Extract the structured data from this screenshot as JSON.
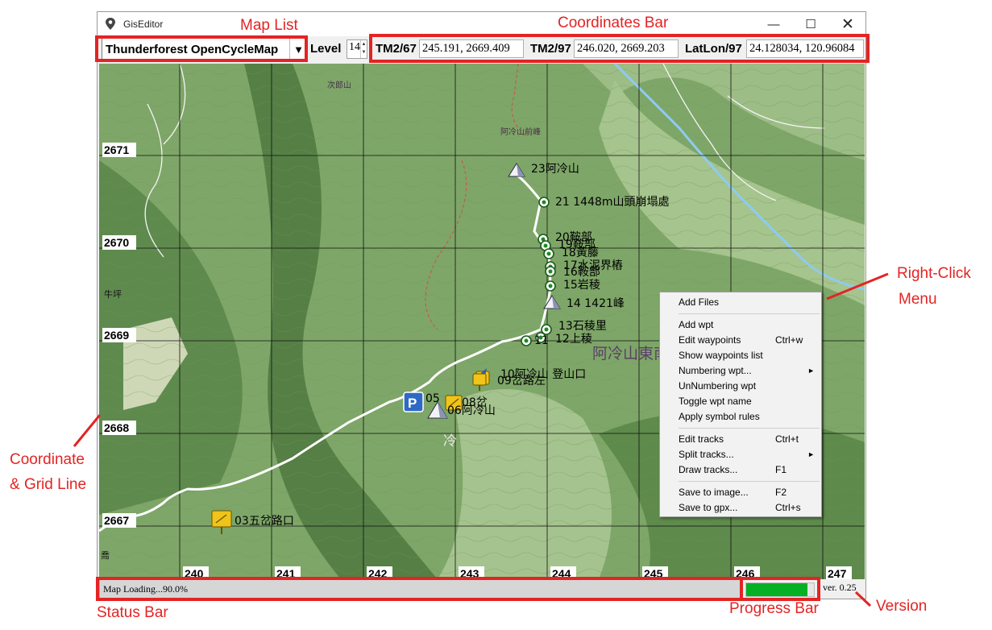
{
  "window": {
    "title": "GisEditor",
    "minimize_glyph": "—",
    "maximize_glyph": "☐",
    "close_glyph": "✕"
  },
  "toolbar": {
    "map_source": "Thunderforest OpenCycleMap",
    "map_dropdown_glyph": "▼",
    "level_label": "Level",
    "level_value": "14",
    "coords": [
      {
        "label": "TM2/67",
        "value": "245.191, 2669.409"
      },
      {
        "label": "TM2/97",
        "value": "246.020, 2669.203"
      },
      {
        "label": "LatLon/97",
        "value": "24.128034, 120.96084"
      }
    ]
  },
  "map": {
    "grid_y_labels": [
      "2671",
      "2670",
      "2669",
      "2668",
      "2667"
    ],
    "grid_x_labels": [
      "240",
      "241",
      "242",
      "243",
      "244",
      "245",
      "246",
      "247"
    ],
    "waypoints": [
      {
        "id": "wp23",
        "label": "23阿冷山",
        "icon": "peak-icon"
      },
      {
        "id": "wp21",
        "label": "21 1448m山頭崩塌處",
        "icon": "circle-waypoint-icon"
      },
      {
        "id": "wp20",
        "label": "20鞍部",
        "icon": "circle-waypoint-icon"
      },
      {
        "id": "wp19",
        "label": "19鞍部",
        "icon": "circle-waypoint-icon"
      },
      {
        "id": "wp18",
        "label": "18黃藤",
        "icon": "circle-waypoint-icon"
      },
      {
        "id": "wp17",
        "label": "17水泥界樁",
        "icon": "circle-waypoint-icon"
      },
      {
        "id": "wp16",
        "label": "16鞍部",
        "icon": "circle-waypoint-icon"
      },
      {
        "id": "wp15",
        "label": "15岩稜",
        "icon": "circle-waypoint-icon"
      },
      {
        "id": "wp14",
        "label": "14 1421峰",
        "icon": "peak-icon"
      },
      {
        "id": "wp13",
        "label": "13石稜里",
        "icon": "circle-waypoint-icon"
      },
      {
        "id": "wp12",
        "label": "12上稜",
        "icon": "circle-waypoint-icon"
      },
      {
        "id": "wp11",
        "label": "11",
        "icon": "circle-waypoint-icon"
      },
      {
        "id": "wp10",
        "label": "10阿冷山 登山口",
        "icon": "trailhead-icon"
      },
      {
        "id": "wp09",
        "label": "09岔路左",
        "icon": "signpost-icon"
      },
      {
        "id": "wp08",
        "label": "08岔",
        "icon": "signpost-icon"
      },
      {
        "id": "wp06",
        "label": "06阿冷山",
        "icon": "peak-icon"
      },
      {
        "id": "wp05",
        "label": "05",
        "icon": "parking-icon"
      },
      {
        "id": "wp03",
        "label": "03五岔路口",
        "icon": "signpost-icon"
      }
    ],
    "place_labels": {
      "nanfeng": "阿冷山東南鋒",
      "qianfeng": "阿冷山前峰",
      "niuping": "牛坪",
      "cilang": "次郎山",
      "mountain": "阿冷山",
      "qiao": "喬",
      "leng": "冷"
    }
  },
  "status": {
    "text": "Map Loading...90.0%",
    "progress": 0.9,
    "version": "ver. 0.25"
  },
  "context_menu": {
    "items": [
      {
        "label": "Add Files",
        "shortcut": ""
      },
      {
        "sep": true
      },
      {
        "label": "Add wpt",
        "shortcut": ""
      },
      {
        "label": "Edit waypoints",
        "shortcut": "Ctrl+w"
      },
      {
        "label": "Show waypoints list",
        "shortcut": ""
      },
      {
        "label": "Numbering wpt...",
        "shortcut": "",
        "submenu": "►"
      },
      {
        "label": "UnNumbering wpt",
        "shortcut": ""
      },
      {
        "label": "Toggle wpt name",
        "shortcut": ""
      },
      {
        "label": "Apply symbol rules",
        "shortcut": ""
      },
      {
        "sep": true
      },
      {
        "label": "Edit tracks",
        "shortcut": "Ctrl+t"
      },
      {
        "label": "Split tracks...",
        "shortcut": "",
        "submenu": "►"
      },
      {
        "label": "Draw tracks...",
        "shortcut": "F1"
      },
      {
        "sep": true
      },
      {
        "label": "Save to image...",
        "shortcut": "F2"
      },
      {
        "label": "Save to gpx...",
        "shortcut": "Ctrl+s"
      }
    ]
  },
  "annotations": {
    "map_list": "Map List",
    "coordinates_bar": "Coordinates Bar",
    "right_click_line1": "Right-Click",
    "right_click_line2": "Menu",
    "coordinate_line1": "Coordinate",
    "coordinate_line2": "& Grid Line",
    "status_bar": "Status Bar",
    "progress_bar": "Progress Bar",
    "version": "Version"
  },
  "colors": {
    "annotation": "#e32424",
    "progress_fill": "#06b025",
    "track": "#ffffff",
    "river": "#8ecbef",
    "road": "#c45a52",
    "map_base": "#7ea668"
  }
}
